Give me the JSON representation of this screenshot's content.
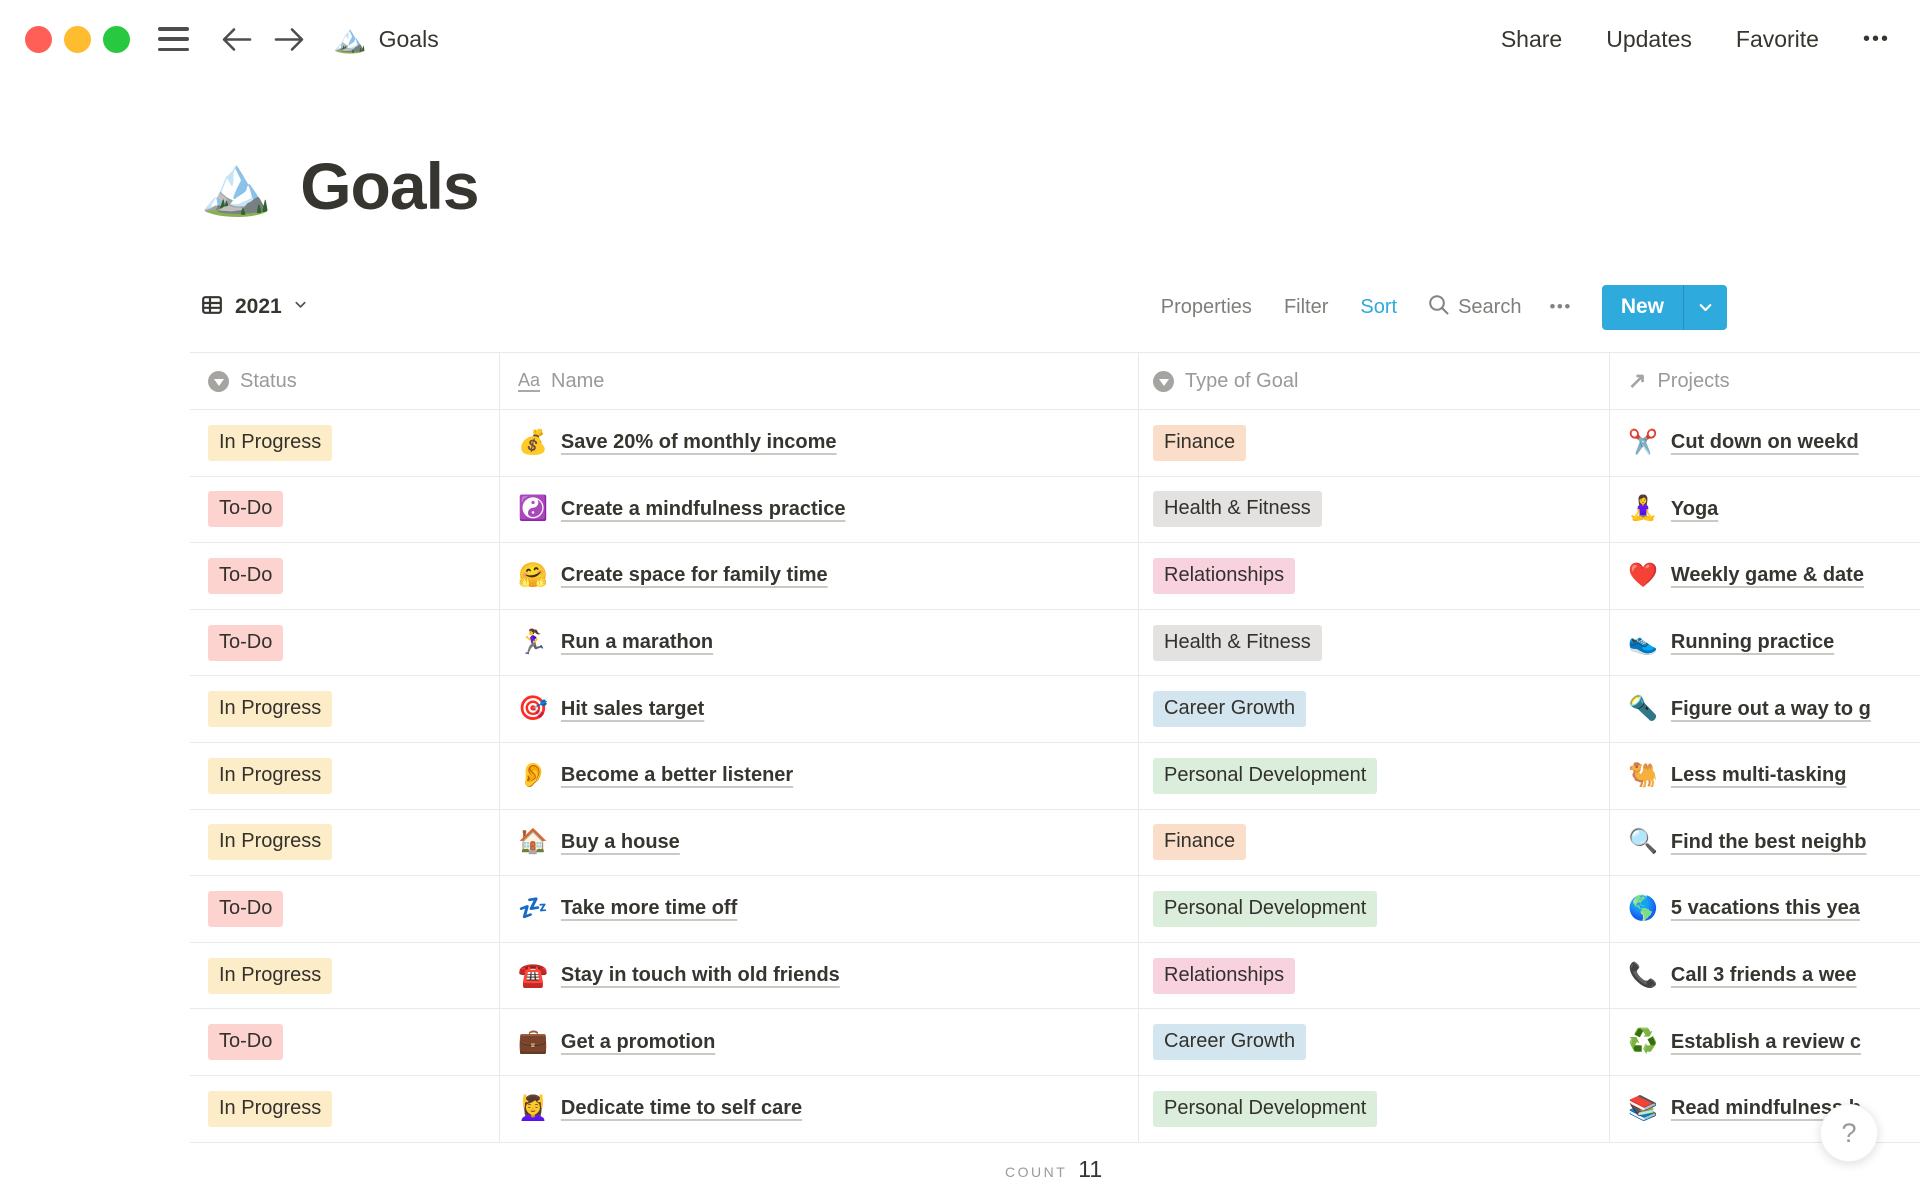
{
  "colors": {
    "accent_blue": "#2eaadc",
    "traffic_red": "#ff5f57",
    "traffic_yellow": "#febc2e",
    "traffic_green": "#28c840",
    "badge_yellow": "#fdecc8",
    "badge_red": "#fdd3d0",
    "badge_orange": "#fadec9",
    "badge_gray": "#e3e2e0",
    "badge_pink": "#f9d2e0",
    "badge_blue": "#d3e5ef",
    "badge_green": "#dbeddb"
  },
  "topbar": {
    "doc_icon": "🏔️",
    "doc_title": "Goals",
    "share": "Share",
    "updates": "Updates",
    "favorite": "Favorite",
    "more": "•••"
  },
  "page": {
    "icon": "🏔️",
    "title": "Goals"
  },
  "toolbar": {
    "view_name": "2021",
    "properties": "Properties",
    "filter": "Filter",
    "sort": "Sort",
    "search": "Search",
    "more": "•••",
    "new": "New"
  },
  "table": {
    "columns": [
      {
        "label": "Status"
      },
      {
        "label": "Name"
      },
      {
        "label": "Type of Goal"
      },
      {
        "label": "Projects"
      }
    ],
    "rows": [
      {
        "status": "In Progress",
        "status_color": "yellow",
        "name_icon": "💰",
        "name": "Save 20% of monthly income",
        "type": "Finance",
        "type_color": "orange",
        "project_icon": "✂️",
        "project": "Cut down on weekd"
      },
      {
        "status": "To-Do",
        "status_color": "red",
        "name_icon": "☯️",
        "name": "Create a mindfulness practice",
        "type": "Health & Fitness",
        "type_color": "gray",
        "project_icon": "🧘‍♀️",
        "project": "Yoga"
      },
      {
        "status": "To-Do",
        "status_color": "red",
        "name_icon": "🤗",
        "name": "Create space for family time",
        "type": "Relationships",
        "type_color": "pink",
        "project_icon": "❤️",
        "project": "Weekly game & date"
      },
      {
        "status": "To-Do",
        "status_color": "red",
        "name_icon": "🏃‍♀️",
        "name": "Run a marathon",
        "type": "Health & Fitness",
        "type_color": "gray",
        "project_icon": "👟",
        "project": "Running practice"
      },
      {
        "status": "In Progress",
        "status_color": "yellow",
        "name_icon": "🎯",
        "name": "Hit sales target",
        "type": "Career Growth",
        "type_color": "blue",
        "project_icon": "🔦",
        "project": "Figure out a way to g"
      },
      {
        "status": "In Progress",
        "status_color": "yellow",
        "name_icon": "👂",
        "name": "Become a better listener",
        "type": "Personal Development",
        "type_color": "green",
        "project_icon": "🐫",
        "project": "Less multi-tasking"
      },
      {
        "status": "In Progress",
        "status_color": "yellow",
        "name_icon": "🏠",
        "name": "Buy a house",
        "type": "Finance",
        "type_color": "orange",
        "project_icon": "🔍",
        "project": "Find the best neighb"
      },
      {
        "status": "To-Do",
        "status_color": "red",
        "name_icon": "💤",
        "name": "Take more time off",
        "type": "Personal Development",
        "type_color": "green",
        "project_icon": "🌎",
        "project": "5 vacations this yea"
      },
      {
        "status": "In Progress",
        "status_color": "yellow",
        "name_icon": "☎️",
        "name": "Stay in touch with old friends",
        "type": "Relationships",
        "type_color": "pink",
        "project_icon": "📞",
        "project": "Call 3 friends a wee"
      },
      {
        "status": "To-Do",
        "status_color": "red",
        "name_icon": "💼",
        "name": "Get a promotion",
        "type": "Career Growth",
        "type_color": "blue",
        "project_icon": "♻️",
        "project": "Establish a review c"
      },
      {
        "status": "In Progress",
        "status_color": "yellow",
        "name_icon": "💆‍♀️",
        "name": "Dedicate time to self care",
        "type": "Personal Development",
        "type_color": "green",
        "project_icon": "📚",
        "project": "Read mindfulness b"
      }
    ],
    "footer": {
      "count_label": "COUNT",
      "count_value": "11"
    }
  },
  "help": {
    "label": "?"
  }
}
